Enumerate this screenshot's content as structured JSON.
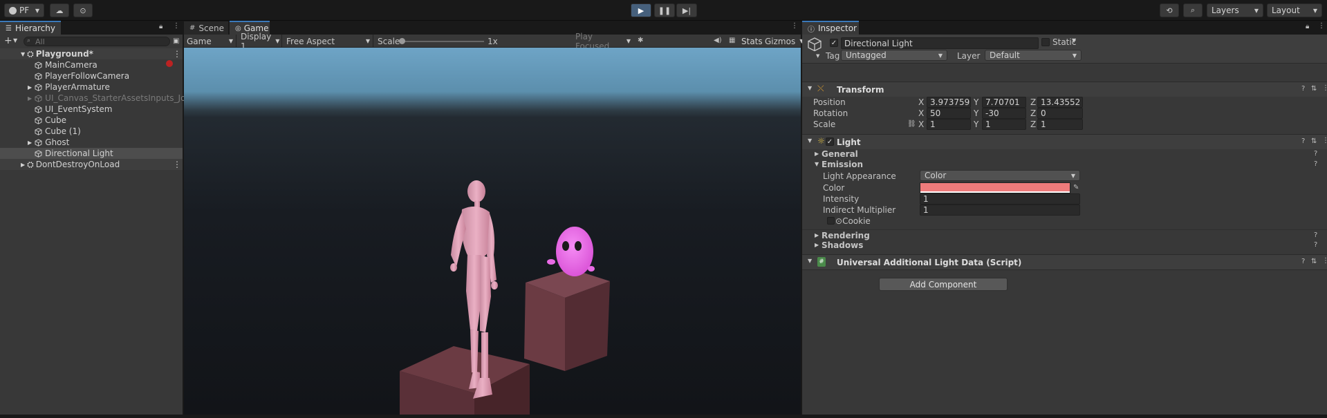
{
  "toolbar": {
    "account_label": "PF",
    "layers_label": "Layers",
    "layout_label": "Layout"
  },
  "hierarchy": {
    "tab_label": "Hierarchy",
    "search_placeholder": "All",
    "scene_name": "Playground*",
    "items": [
      {
        "label": "MainCamera"
      },
      {
        "label": "PlayerFollowCamera"
      },
      {
        "label": "PlayerArmature"
      },
      {
        "label": "UI_Canvas_StarterAssetsInputs_Joysticks"
      },
      {
        "label": "UI_EventSystem"
      },
      {
        "label": "Cube"
      },
      {
        "label": "Cube (1)"
      },
      {
        "label": "Ghost"
      },
      {
        "label": "Directional Light"
      }
    ],
    "ddol_label": "DontDestroyOnLoad"
  },
  "game": {
    "tab_scene": "Scene",
    "tab_game": "Game",
    "game_dropdown": "Game",
    "display_dropdown": "Display 1",
    "aspect_dropdown": "Free Aspect",
    "scale_label": "Scale",
    "scale_value": "1x",
    "scale_fraction": 0.0,
    "play_focused": "Play Focused",
    "stats_label": "Stats",
    "gizmos_label": "Gizmos"
  },
  "inspector": {
    "tab_label": "Inspector",
    "object_name": "Directional Light",
    "static_label": "Static",
    "tag_label": "Tag",
    "tag_value": "Untagged",
    "layer_label": "Layer",
    "layer_value": "Default",
    "transform": {
      "title": "Transform",
      "position_label": "Position",
      "rotation_label": "Rotation",
      "scale_label": "Scale",
      "position": {
        "x": "3.973759",
        "y": "7.70701",
        "z": "13.43552"
      },
      "rotation": {
        "x": "50",
        "y": "-30",
        "z": "0"
      },
      "scale": {
        "x": "1",
        "y": "1",
        "z": "1"
      },
      "axis_x": "X",
      "axis_y": "Y",
      "axis_z": "Z"
    },
    "light": {
      "title": "Light",
      "general_label": "General",
      "emission_label": "Emission",
      "appearance_label": "Light Appearance",
      "appearance_value": "Color",
      "color_label": "Color",
      "color_value": "#ee7b7b",
      "intensity_label": "Intensity",
      "intensity_value": "1",
      "indirect_label": "Indirect Multiplier",
      "indirect_value": "1",
      "cookie_label": "Cookie",
      "rendering_label": "Rendering",
      "shadows_label": "Shadows"
    },
    "urp_label": "Universal Additional Light Data (Script)",
    "add_component_label": "Add Component"
  },
  "colors": {
    "accent": "#3a79bb",
    "character": "#e8a3ba",
    "ghost": "#ef73ee",
    "cube": "#6b3b43"
  }
}
